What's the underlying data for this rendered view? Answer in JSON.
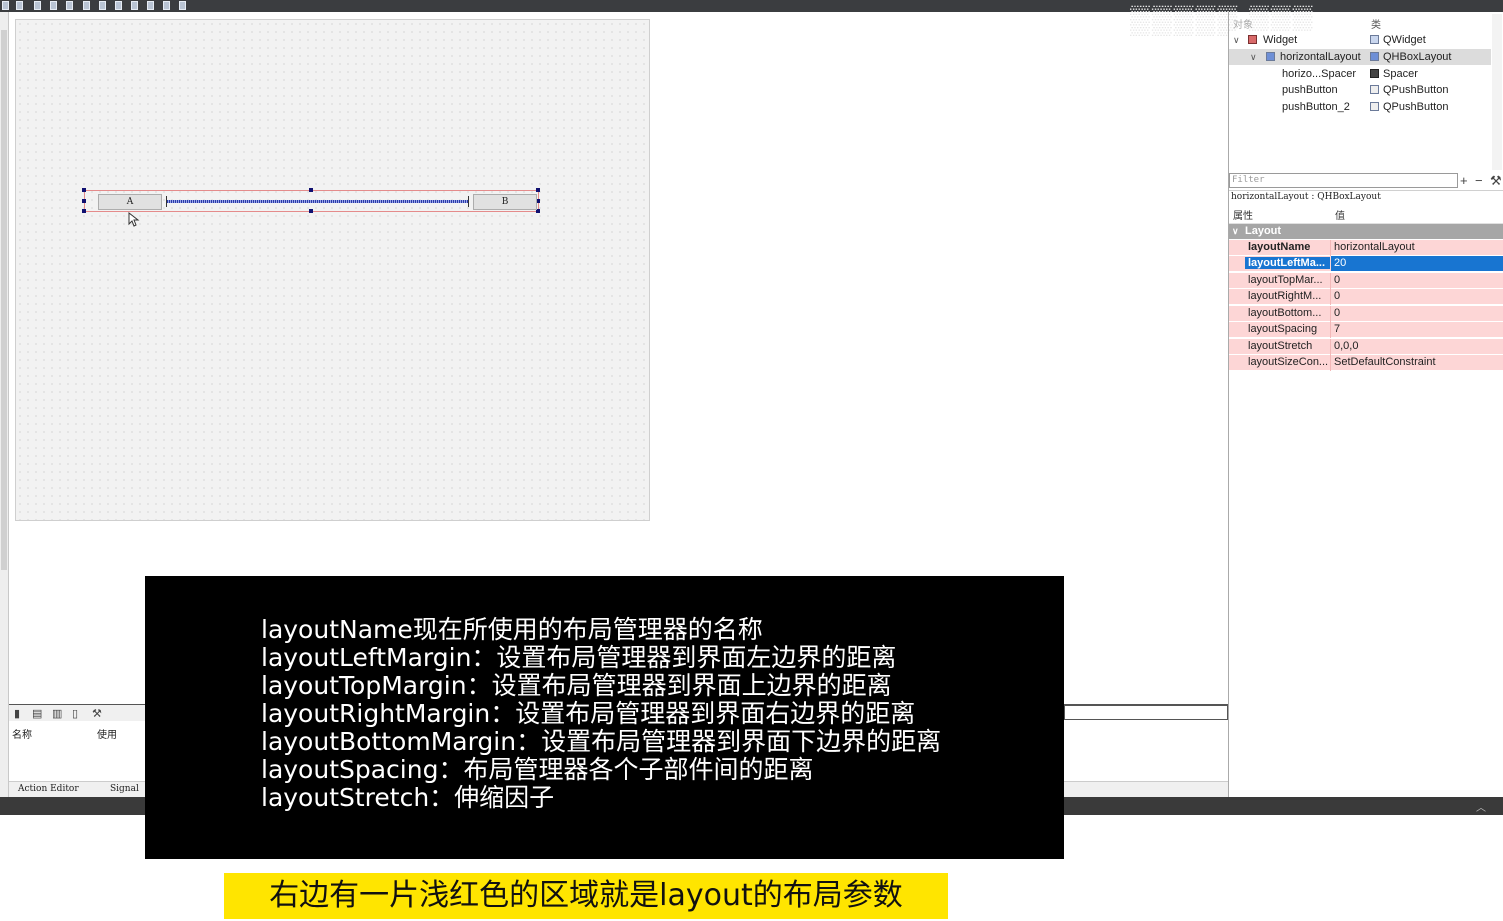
{
  "object_tree": {
    "header_col1": "对象",
    "header_col2": "类",
    "rows": [
      {
        "name": "Widget",
        "class": "QWidget",
        "icon": "widget-icon"
      },
      {
        "name": "horizontalLayout",
        "class": "QHBoxLayout",
        "icon": "hbox-layout-icon"
      },
      {
        "name": "horizo...Spacer",
        "class": "Spacer",
        "icon": "spacer-icon"
      },
      {
        "name": "pushButton",
        "class": "QPushButton",
        "icon": "pushbutton-icon"
      },
      {
        "name": "pushButton_2",
        "class": "QPushButton",
        "icon": "pushbutton-icon"
      }
    ]
  },
  "property_editor": {
    "filter_placeholder": "Filter",
    "object_label": "horizontalLayout : QHBoxLayout",
    "col_property": "属性",
    "col_value": "值",
    "section": "Layout",
    "rows": [
      {
        "key": "layoutName",
        "value": "horizontalLayout"
      },
      {
        "key": "layoutLeftMa...",
        "value": "20"
      },
      {
        "key": "layoutTopMar...",
        "value": "0"
      },
      {
        "key": "layoutRightM...",
        "value": "0"
      },
      {
        "key": "layoutBottom...",
        "value": "0"
      },
      {
        "key": "layoutSpacing",
        "value": "7"
      },
      {
        "key": "layoutStretch",
        "value": "0,0,0"
      },
      {
        "key": "layoutSizeCon...",
        "value": "SetDefaultConstraint"
      }
    ],
    "selected_row": "layoutLeftMa...",
    "colors": {
      "modified_row": "#fdd6d6",
      "selection": "#1875d1",
      "section": "#a6a6a6"
    }
  },
  "form": {
    "button_a": "A",
    "button_b": "B"
  },
  "action_editor": {
    "col_name": "名称",
    "col_used": "使用",
    "tabs": [
      "Action Editor",
      "Signal"
    ]
  },
  "caption": {
    "lines": [
      "layoutName现在所使用的布局管理器的名称",
      "layoutLeftMargin：设置布局管理器到界面左边界的距离",
      "layoutTopMargin：设置布局管理器到界面上边界的距离",
      "layoutRightMargin：设置布局管理器到界面右边界的距离",
      "layoutBottomMargin：设置布局管理器到界面下边界的距离",
      "layoutSpacing：布局管理器各个子部件间的距离",
      "layoutStretch：伸缩因子"
    ],
    "subtitle": "右边有一片浅红色的区域就是layout的布局参数"
  }
}
